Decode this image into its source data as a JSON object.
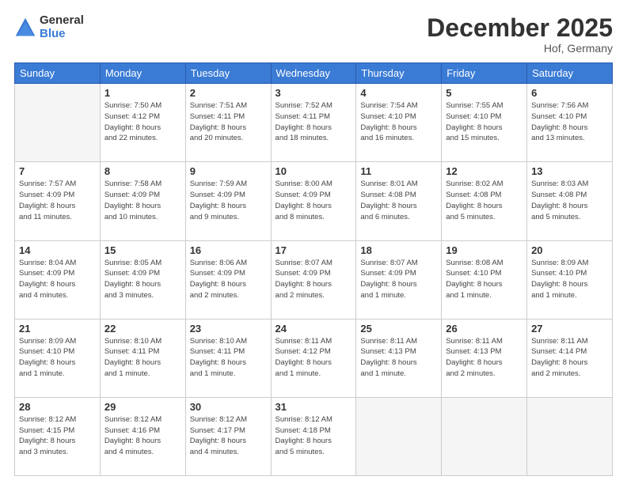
{
  "header": {
    "logo_general": "General",
    "logo_blue": "Blue",
    "month_title": "December 2025",
    "location": "Hof, Germany"
  },
  "calendar": {
    "days_of_week": [
      "Sunday",
      "Monday",
      "Tuesday",
      "Wednesday",
      "Thursday",
      "Friday",
      "Saturday"
    ],
    "weeks": [
      [
        {
          "day": "",
          "info": ""
        },
        {
          "day": "1",
          "info": "Sunrise: 7:50 AM\nSunset: 4:12 PM\nDaylight: 8 hours\nand 22 minutes."
        },
        {
          "day": "2",
          "info": "Sunrise: 7:51 AM\nSunset: 4:11 PM\nDaylight: 8 hours\nand 20 minutes."
        },
        {
          "day": "3",
          "info": "Sunrise: 7:52 AM\nSunset: 4:11 PM\nDaylight: 8 hours\nand 18 minutes."
        },
        {
          "day": "4",
          "info": "Sunrise: 7:54 AM\nSunset: 4:10 PM\nDaylight: 8 hours\nand 16 minutes."
        },
        {
          "day": "5",
          "info": "Sunrise: 7:55 AM\nSunset: 4:10 PM\nDaylight: 8 hours\nand 15 minutes."
        },
        {
          "day": "6",
          "info": "Sunrise: 7:56 AM\nSunset: 4:10 PM\nDaylight: 8 hours\nand 13 minutes."
        }
      ],
      [
        {
          "day": "7",
          "info": "Sunrise: 7:57 AM\nSunset: 4:09 PM\nDaylight: 8 hours\nand 11 minutes."
        },
        {
          "day": "8",
          "info": "Sunrise: 7:58 AM\nSunset: 4:09 PM\nDaylight: 8 hours\nand 10 minutes."
        },
        {
          "day": "9",
          "info": "Sunrise: 7:59 AM\nSunset: 4:09 PM\nDaylight: 8 hours\nand 9 minutes."
        },
        {
          "day": "10",
          "info": "Sunrise: 8:00 AM\nSunset: 4:09 PM\nDaylight: 8 hours\nand 8 minutes."
        },
        {
          "day": "11",
          "info": "Sunrise: 8:01 AM\nSunset: 4:08 PM\nDaylight: 8 hours\nand 6 minutes."
        },
        {
          "day": "12",
          "info": "Sunrise: 8:02 AM\nSunset: 4:08 PM\nDaylight: 8 hours\nand 5 minutes."
        },
        {
          "day": "13",
          "info": "Sunrise: 8:03 AM\nSunset: 4:08 PM\nDaylight: 8 hours\nand 5 minutes."
        }
      ],
      [
        {
          "day": "14",
          "info": "Sunrise: 8:04 AM\nSunset: 4:09 PM\nDaylight: 8 hours\nand 4 minutes."
        },
        {
          "day": "15",
          "info": "Sunrise: 8:05 AM\nSunset: 4:09 PM\nDaylight: 8 hours\nand 3 minutes."
        },
        {
          "day": "16",
          "info": "Sunrise: 8:06 AM\nSunset: 4:09 PM\nDaylight: 8 hours\nand 2 minutes."
        },
        {
          "day": "17",
          "info": "Sunrise: 8:07 AM\nSunset: 4:09 PM\nDaylight: 8 hours\nand 2 minutes."
        },
        {
          "day": "18",
          "info": "Sunrise: 8:07 AM\nSunset: 4:09 PM\nDaylight: 8 hours\nand 1 minute."
        },
        {
          "day": "19",
          "info": "Sunrise: 8:08 AM\nSunset: 4:10 PM\nDaylight: 8 hours\nand 1 minute."
        },
        {
          "day": "20",
          "info": "Sunrise: 8:09 AM\nSunset: 4:10 PM\nDaylight: 8 hours\nand 1 minute."
        }
      ],
      [
        {
          "day": "21",
          "info": "Sunrise: 8:09 AM\nSunset: 4:10 PM\nDaylight: 8 hours\nand 1 minute."
        },
        {
          "day": "22",
          "info": "Sunrise: 8:10 AM\nSunset: 4:11 PM\nDaylight: 8 hours\nand 1 minute."
        },
        {
          "day": "23",
          "info": "Sunrise: 8:10 AM\nSunset: 4:11 PM\nDaylight: 8 hours\nand 1 minute."
        },
        {
          "day": "24",
          "info": "Sunrise: 8:11 AM\nSunset: 4:12 PM\nDaylight: 8 hours\nand 1 minute."
        },
        {
          "day": "25",
          "info": "Sunrise: 8:11 AM\nSunset: 4:13 PM\nDaylight: 8 hours\nand 1 minute."
        },
        {
          "day": "26",
          "info": "Sunrise: 8:11 AM\nSunset: 4:13 PM\nDaylight: 8 hours\nand 2 minutes."
        },
        {
          "day": "27",
          "info": "Sunrise: 8:11 AM\nSunset: 4:14 PM\nDaylight: 8 hours\nand 2 minutes."
        }
      ],
      [
        {
          "day": "28",
          "info": "Sunrise: 8:12 AM\nSunset: 4:15 PM\nDaylight: 8 hours\nand 3 minutes."
        },
        {
          "day": "29",
          "info": "Sunrise: 8:12 AM\nSunset: 4:16 PM\nDaylight: 8 hours\nand 4 minutes."
        },
        {
          "day": "30",
          "info": "Sunrise: 8:12 AM\nSunset: 4:17 PM\nDaylight: 8 hours\nand 4 minutes."
        },
        {
          "day": "31",
          "info": "Sunrise: 8:12 AM\nSunset: 4:18 PM\nDaylight: 8 hours\nand 5 minutes."
        },
        {
          "day": "",
          "info": ""
        },
        {
          "day": "",
          "info": ""
        },
        {
          "day": "",
          "info": ""
        }
      ]
    ]
  }
}
